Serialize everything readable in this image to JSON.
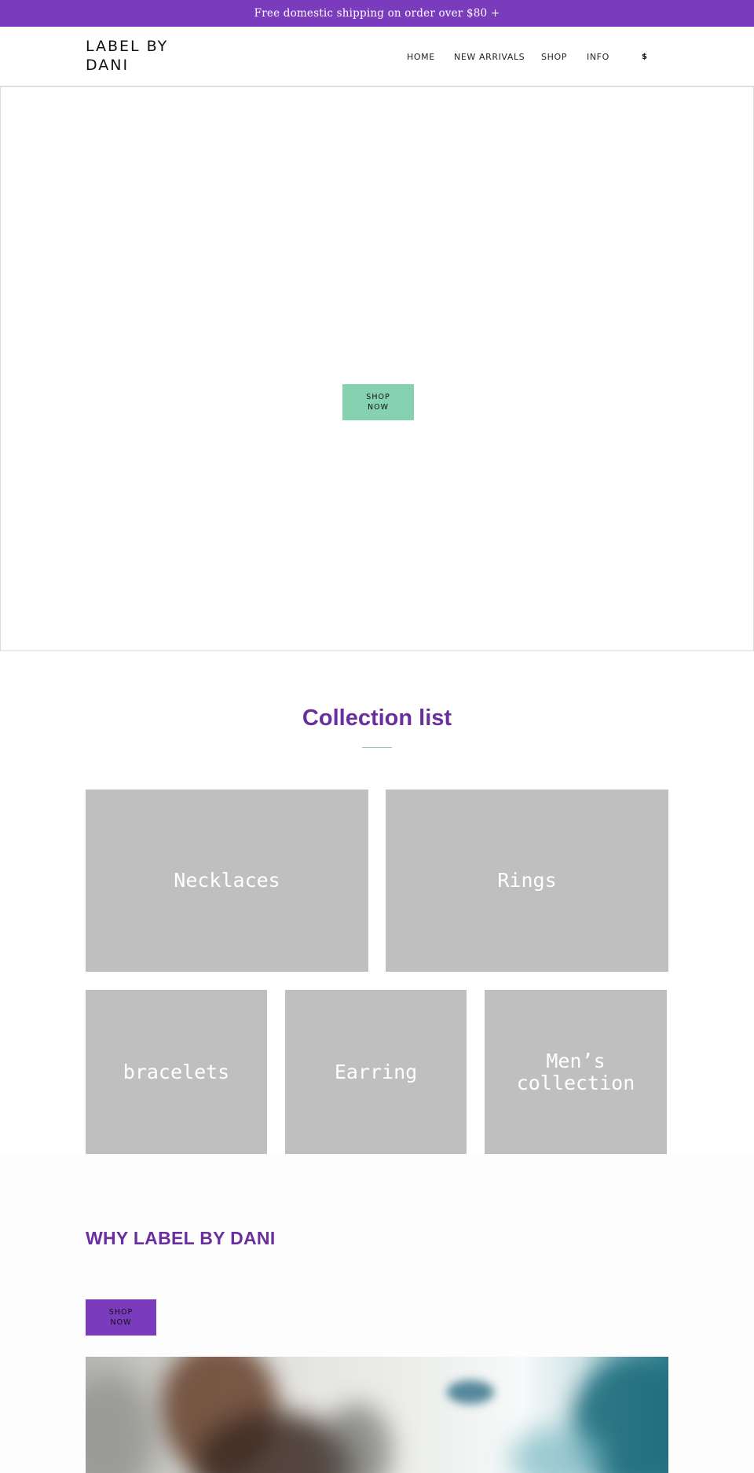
{
  "announcement": "Free domestic shipping on order over $80 +",
  "header": {
    "logo": "LABEL BY DANI",
    "nav": [
      "HOME",
      "NEW ARRIVALS",
      "SHOP",
      "INFO"
    ],
    "currency": "$"
  },
  "hero": {
    "button": "SHOP NOW"
  },
  "collections": {
    "title": "Collection list",
    "items": [
      "Necklaces",
      "Rings",
      "bracelets",
      "Earring",
      "Men’s collection"
    ]
  },
  "why": {
    "title": "WHY LABEL BY DANI",
    "button": "SHOP NOW"
  },
  "colors": {
    "brand_purple": "#7a3bbd",
    "heading_purple": "#6a2f9c",
    "mint_button": "#86d1b0",
    "tile_gray": "#bfbfbf"
  }
}
